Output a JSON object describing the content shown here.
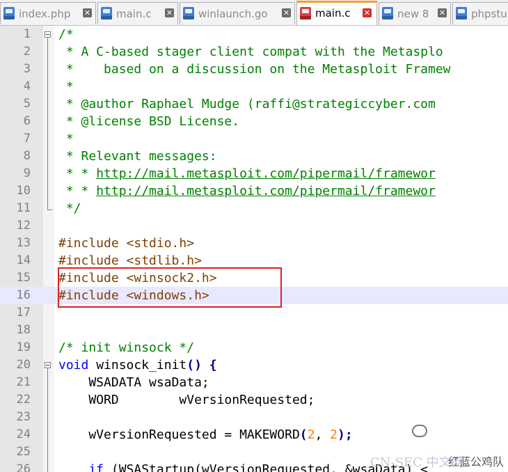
{
  "tabs": [
    {
      "label": "index.php",
      "active": false
    },
    {
      "label": "main.c",
      "active": false
    },
    {
      "label": "winlaunch.go",
      "active": false
    },
    {
      "label": "main.c",
      "active": true
    },
    {
      "label": "new 8",
      "active": false
    },
    {
      "label": "phpstu",
      "active": false
    }
  ],
  "lines": [
    {
      "n": "1",
      "text": "/*"
    },
    {
      "n": "2",
      "text": " * A C-based stager client compat with the Metasplo"
    },
    {
      "n": "3",
      "text": " *    based on a discussion on the Metasploit Framew"
    },
    {
      "n": "4",
      "text": " *"
    },
    {
      "n": "5",
      "text": " * @author Raphael Mudge (raffi@strategiccyber.com"
    },
    {
      "n": "6",
      "text": " * @license BSD License."
    },
    {
      "n": "7",
      "text": " *"
    },
    {
      "n": "8",
      "text": " * Relevant messages:"
    },
    {
      "n": "9",
      "text": " * * ",
      "url": "http://mail.metasploit.com/pipermail/framewor"
    },
    {
      "n": "10",
      "text": " * * ",
      "url": "http://mail.metasploit.com/pipermail/framewor"
    },
    {
      "n": "11",
      "text": " */"
    },
    {
      "n": "12",
      "text": ""
    },
    {
      "n": "13",
      "pre": "#include",
      "arg": " <stdio.h>"
    },
    {
      "n": "14",
      "pre": "#include",
      "arg": " <stdlib.h>"
    },
    {
      "n": "15",
      "pre": "#include",
      "arg": " <winsock2.h>"
    },
    {
      "n": "16",
      "pre": "#include",
      "arg": " <windows.h>"
    },
    {
      "n": "17",
      "text": ""
    },
    {
      "n": "18",
      "text": ""
    },
    {
      "n": "19",
      "text": "/* init winsock */"
    },
    {
      "n": "20",
      "kw": "void",
      "rest": " winsock_init",
      "op": "()",
      "rest2": " ",
      "op2": "{"
    },
    {
      "n": "21",
      "plain": "    WSADATA wsaData;"
    },
    {
      "n": "22",
      "plain": "    WORD        wVersionRequested;"
    },
    {
      "n": "23",
      "plain": ""
    },
    {
      "n": "24",
      "plain": "    wVersionRequested = MAKEWORD",
      "op": "(",
      "num1": "2",
      ", ": "",
      ",": ", ",
      "num2": "2",
      "op2": ");"
    },
    {
      "n": "25",
      "plain": ""
    },
    {
      "n": "26",
      "kw": "    if",
      "rest": " (WSAStartup(wVersionRequested, &wsaData) <"
    }
  ],
  "watermark": {
    "brand": "红蓝公鸡队",
    "site": "CN-SEC 中文网"
  }
}
